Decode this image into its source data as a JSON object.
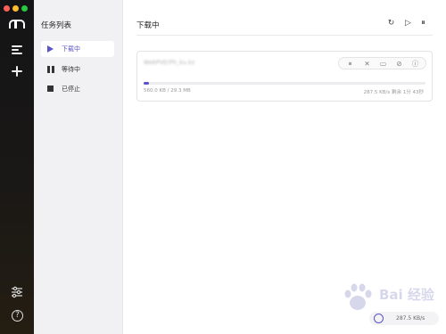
{
  "window": {
    "traffic_lights": [
      "#fe5f57",
      "#febc2e",
      "#28c840"
    ]
  },
  "rail": {
    "logo_icon": "motrix-logo",
    "menu_icon": "hamburger-menu-icon",
    "add_icon": "plus-icon",
    "settings_icon": "sliders-icon",
    "help_icon": "question-icon",
    "help_glyph": "?"
  },
  "sidebar": {
    "title": "任务列表",
    "items": [
      {
        "label": "下载中",
        "icon": "play-icon",
        "active": true
      },
      {
        "label": "等待中",
        "icon": "pause-icon",
        "active": false
      },
      {
        "label": "已停止",
        "icon": "stop-icon",
        "active": false
      }
    ]
  },
  "main": {
    "title": "下载中",
    "header_actions": [
      {
        "name": "refresh-icon",
        "glyph": "↻"
      },
      {
        "name": "resume-all-icon",
        "glyph": "▷"
      },
      {
        "name": "pause-all-icon",
        "glyph": "⏸"
      }
    ]
  },
  "task": {
    "name": "WebPVE(Ph_ku.kz",
    "progress_fraction": 0.02,
    "size": "560.0 KB / 29.3 MB",
    "speed": "287.5 KB/s 剩余 1分 43秒",
    "actions": [
      {
        "name": "pause-icon",
        "glyph": "⏸"
      },
      {
        "name": "delete-icon",
        "glyph": "✕"
      },
      {
        "name": "folder-icon",
        "glyph": "▭"
      },
      {
        "name": "link-icon",
        "glyph": "⊘"
      },
      {
        "name": "info-icon",
        "glyph": "ⓘ"
      }
    ]
  },
  "status": {
    "speed": "287.5 KB/s"
  },
  "watermark": {
    "text": "Bai 经验",
    "color": "#2a2a9a"
  },
  "colors": {
    "accent": "#5b54c9",
    "rail": "#141416",
    "sidebar": "#f1f1f3"
  }
}
